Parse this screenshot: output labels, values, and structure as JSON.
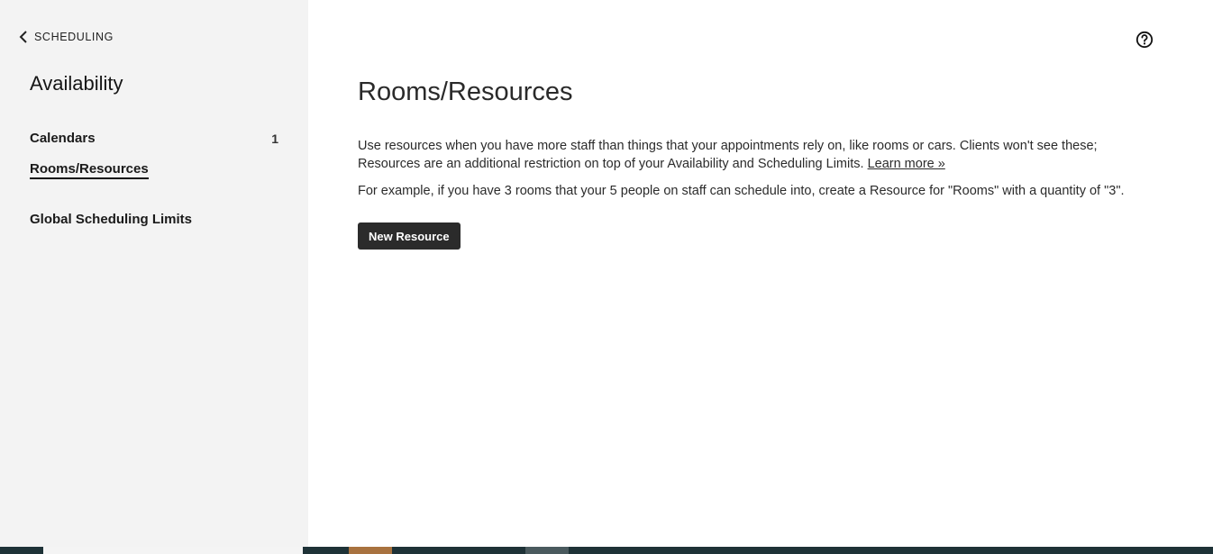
{
  "sidebar": {
    "back_label": "SCHEDULING",
    "title": "Availability",
    "items": [
      {
        "label": "Calendars",
        "count": "1"
      },
      {
        "label": "Rooms/Resources",
        "count": ""
      },
      {
        "label": "Global Scheduling Limits",
        "count": ""
      }
    ],
    "active_item": "Rooms/Resources"
  },
  "main": {
    "title": "Rooms/Resources",
    "description_line1": "Use resources when you have more staff than things that your appointments rely on, like rooms or cars. Clients won't see these;",
    "description_line2": "Resources are an additional restriction on top of your Availability and Scheduling Limits.",
    "learn_more": "Learn more »",
    "example": "For example, if you have 3 rooms that your 5 people on staff can schedule into, create a Resource for \"Rooms\" with a quantity of \"3\".",
    "new_button": "New Resource"
  },
  "icons": {
    "back": "chevron-left-icon",
    "help": "question-circle-icon"
  },
  "colors": {
    "sidebar_bg": "#f3f3f3",
    "button_bg": "#2b2b2b",
    "taskbar_bg": "#1e3237"
  }
}
